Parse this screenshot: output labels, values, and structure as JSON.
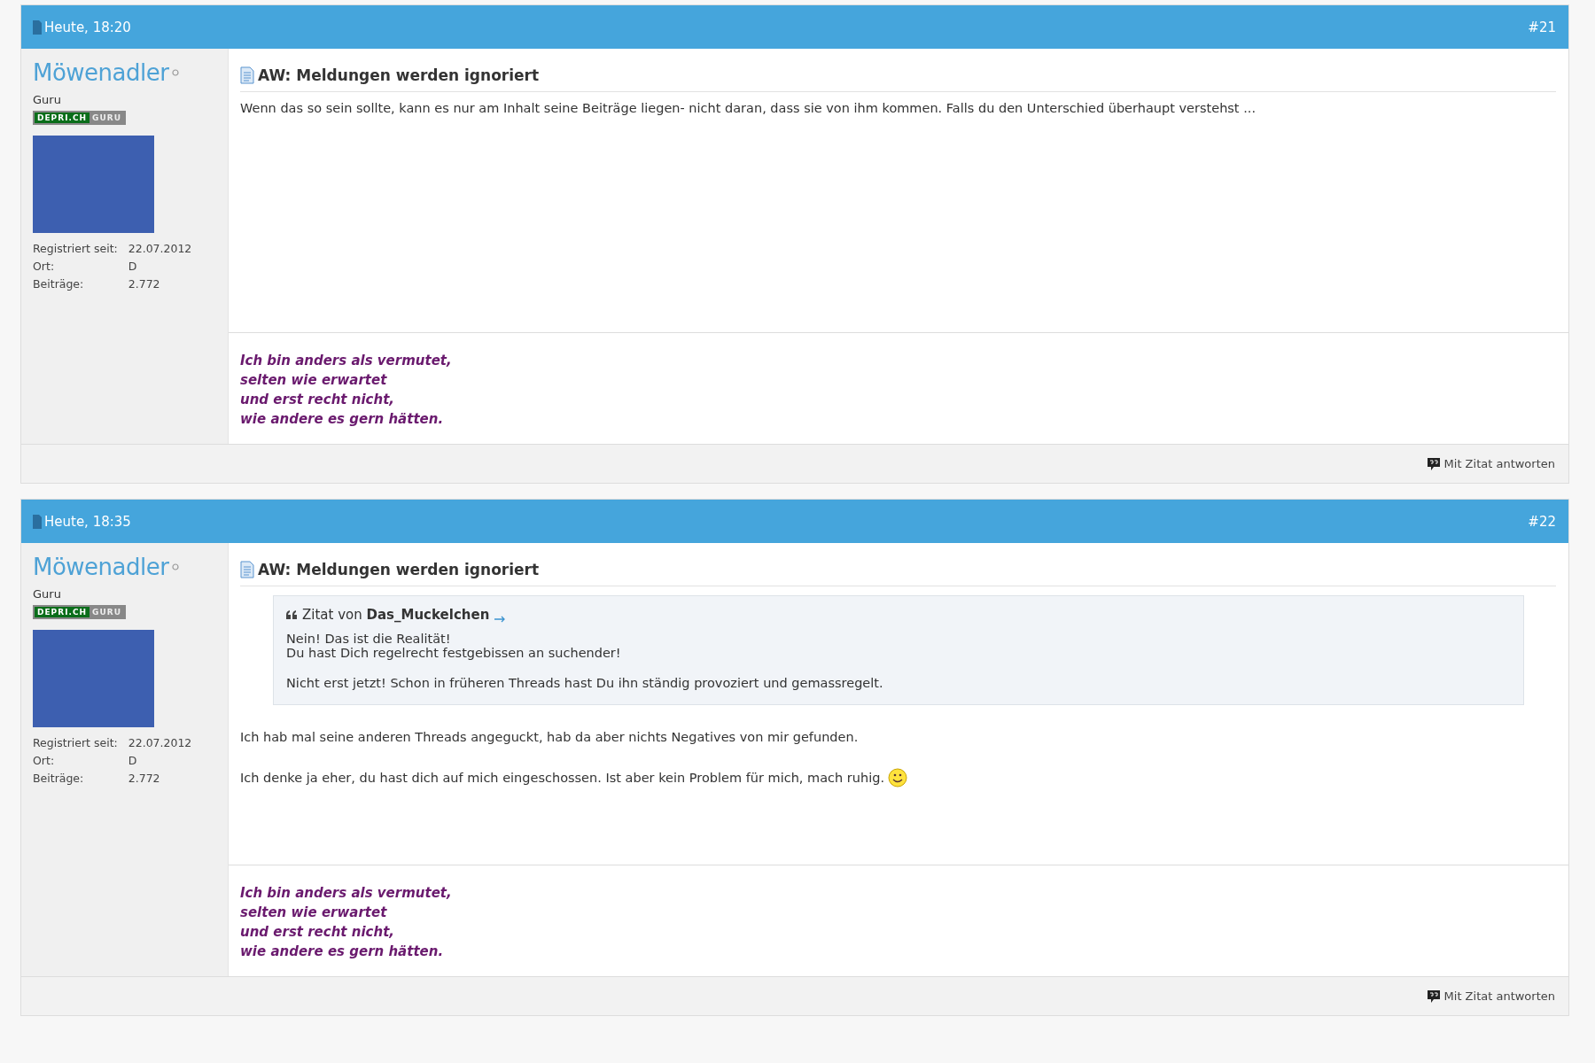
{
  "posts": [
    {
      "date": "Heute, 18:20",
      "number": "#21",
      "author": {
        "name": "Möwenadler",
        "online": false,
        "rank": "Guru",
        "badge": [
          "DEPRI.CH",
          "GURU"
        ],
        "stats": [
          {
            "label": "Registriert seit:",
            "value": "22.07.2012"
          },
          {
            "label": "Ort:",
            "value": "D"
          },
          {
            "label": "Beiträge:",
            "value": "2.772"
          }
        ]
      },
      "title": "AW: Meldungen werden ignoriert",
      "body": [
        {
          "kind": "paragraph",
          "text": "Wenn das so sein sollte, kann es nur am Inhalt seine Beiträge liegen- nicht daran, dass sie von ihm kommen. Falls du den Unterschied überhaupt verstehst ...",
          "smiley": false
        }
      ],
      "signature": "Ich bin anders als vermutet,\nselten wie erwartet\nund erst recht nicht,\nwie andere es gern hätten.",
      "reply_button": "Mit Zitat antworten"
    },
    {
      "date": "Heute, 18:35",
      "number": "#22",
      "author": {
        "name": "Möwenadler",
        "online": false,
        "rank": "Guru",
        "badge": [
          "DEPRI.CH",
          "GURU"
        ],
        "stats": [
          {
            "label": "Registriert seit:",
            "value": "22.07.2012"
          },
          {
            "label": "Ort:",
            "value": "D"
          },
          {
            "label": "Beiträge:",
            "value": "2.772"
          }
        ]
      },
      "title": "AW: Meldungen werden ignoriert",
      "body": [
        {
          "kind": "quote",
          "heading": "Zitat von **Das_Muckelchen**",
          "paragraphs": [
            "Nein! Das ist die Realität!\nDu hast Dich regelrecht festgebissen an suchender!",
            "Nicht erst jetzt! Schon in früheren Threads hast Du ihn ständig provoziert und gemassregelt."
          ]
        },
        {
          "kind": "paragraph",
          "text": "Ich hab mal seine anderen Threads angeguckt, hab da aber nichts Negatives von mir gefunden.",
          "smiley": false
        },
        {
          "kind": "paragraph",
          "text": "Ich denke ja eher, du hast dich auf mich eingeschossen. Ist aber kein Problem für mich, mach ruhig.",
          "smiley": true
        }
      ],
      "signature": "Ich bin anders als vermutet,\nselten wie erwartet\nund erst recht nicht,\nwie andere es gern hätten.",
      "reply_button": "Mit Zitat antworten"
    }
  ]
}
